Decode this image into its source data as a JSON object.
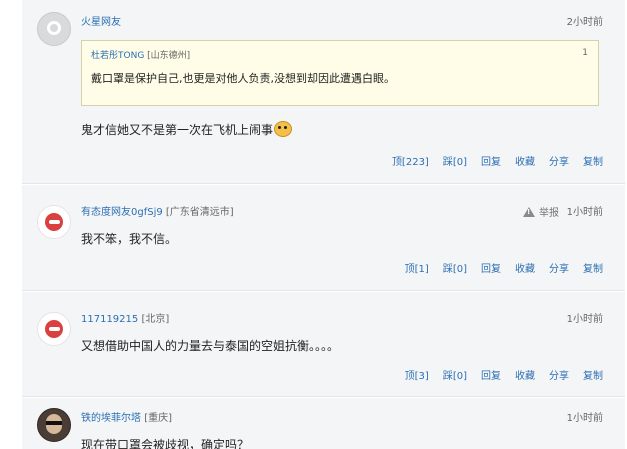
{
  "comments": [
    {
      "user": "火星网友",
      "time": "2小时前",
      "quote": {
        "user": "杜若彤TONG",
        "location": "[山东德州]",
        "num": "1",
        "text": "戴口罩是保护自己,也更是对他人负责,没想到却因此遭遇白眼。"
      },
      "text": "鬼才信她又不是第一次在飞机上闹事",
      "actions": {
        "up": "顶[223]",
        "down": "踩[0]",
        "reply": "回复",
        "fav": "收藏",
        "share": "分享",
        "copy": "复制"
      }
    },
    {
      "user": "有态度网友0gfSj9",
      "location": "[广东省清远市]",
      "report": "举报",
      "time": "1小时前",
      "text": "我不笨，我不信。",
      "actions": {
        "up": "顶[1]",
        "down": "踩[0]",
        "reply": "回复",
        "fav": "收藏",
        "share": "分享",
        "copy": "复制"
      }
    },
    {
      "user": "117119215",
      "location": "[北京]",
      "time": "1小时前",
      "text": "又想借助中国人的力量去与泰国的空姐抗衡。。。。",
      "actions": {
        "up": "顶[3]",
        "down": "踩[0]",
        "reply": "回复",
        "fav": "收藏",
        "share": "分享",
        "copy": "复制"
      }
    },
    {
      "user": "铁的埃菲尔塔",
      "location": "[重庆]",
      "time": "1小时前",
      "text": "现在带口罩会被歧视，确定吗？"
    }
  ],
  "icons": {
    "emoji": "smiley-emoji-icon",
    "warning": "warning-triangle-icon"
  },
  "colors": {
    "link": "#2b6fb3",
    "quote_bg": "#fffde8",
    "card_bg": "#f4f5f7"
  }
}
